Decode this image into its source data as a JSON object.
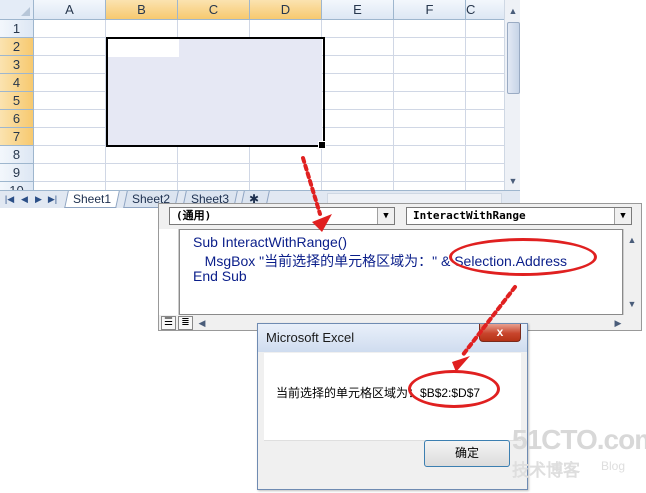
{
  "sheet": {
    "columns": [
      "A",
      "B",
      "C",
      "D",
      "E",
      "F",
      "C"
    ],
    "rows": [
      "1",
      "2",
      "3",
      "4",
      "5",
      "6",
      "7",
      "8",
      "9",
      "10"
    ],
    "tabs": [
      "Sheet1",
      "Sheet2",
      "Sheet3"
    ],
    "nav_buttons": [
      "first",
      "prev",
      "next",
      "last"
    ]
  },
  "editor": {
    "object_combo": "(通用)",
    "proc_combo": "InteractWithRange",
    "code_lines": [
      "Sub InteractWithRange()",
      "    MsgBox \"当前选择的单元格区域为：\" & Selection.Address",
      "End Sub"
    ],
    "highlight": "Selection.Address"
  },
  "msgbox": {
    "title": "Microsoft Excel",
    "message_prefix": "当前选择的单元格区域为：",
    "message_value": "$B$2:$D$7",
    "close_label": "x",
    "ok_label": "确定"
  },
  "watermark": {
    "line1": "51CTO.com",
    "line2": "技术博客",
    "line3": "Blog"
  },
  "colors": {
    "annotation_red": "#e02020",
    "selection_fill": "#e6e8f4",
    "header_selected": "#f7c96f"
  }
}
